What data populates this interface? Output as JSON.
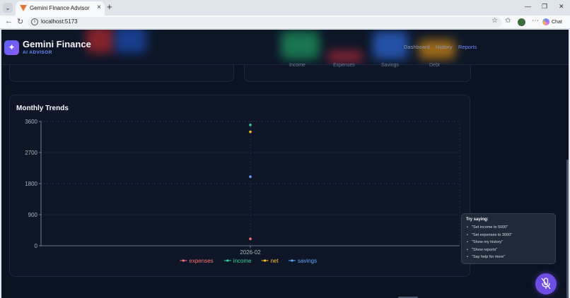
{
  "browser": {
    "tab_title": "Gemini Finance Advisor",
    "new_tab": "+",
    "tab_close": "×",
    "url": "localhost:5173",
    "chat_label": "Chat"
  },
  "app": {
    "brand": "Gemini Finance",
    "brand_sub": "AI ADVISOR",
    "nav": [
      "Dashboard",
      "History",
      "Reports"
    ],
    "active_nav": "Reports",
    "stats_labels": [
      "Income",
      "Expenses",
      "Savings",
      "Debt"
    ],
    "accent_color": "#6c8cff"
  },
  "trends": {
    "title": "Monthly Trends"
  },
  "chart_data": {
    "type": "scatter",
    "title": "Monthly Trends",
    "categories": [
      "2026-02"
    ],
    "yticks": [
      0,
      900,
      1800,
      2700,
      3600
    ],
    "ylim": [
      0,
      3600
    ],
    "grid": true,
    "legend_placement": "bottom",
    "series": [
      {
        "name": "expenses",
        "values": [
          200
        ],
        "color": "#f87171"
      },
      {
        "name": "income",
        "values": [
          3500
        ],
        "color": "#34d399"
      },
      {
        "name": "net",
        "values": [
          3300
        ],
        "color": "#fbbf24"
      },
      {
        "name": "savings",
        "values": [
          2000
        ],
        "color": "#60a5fa"
      }
    ]
  },
  "hint": {
    "title": "Try saying:",
    "items": [
      "\"Set income to 5000\"",
      "\"Set expenses to 3000\"",
      "\"Show my history\"",
      "\"Show reports\"",
      "\"Say help for more\""
    ]
  },
  "icons": {
    "mic": "mic-off-icon"
  }
}
